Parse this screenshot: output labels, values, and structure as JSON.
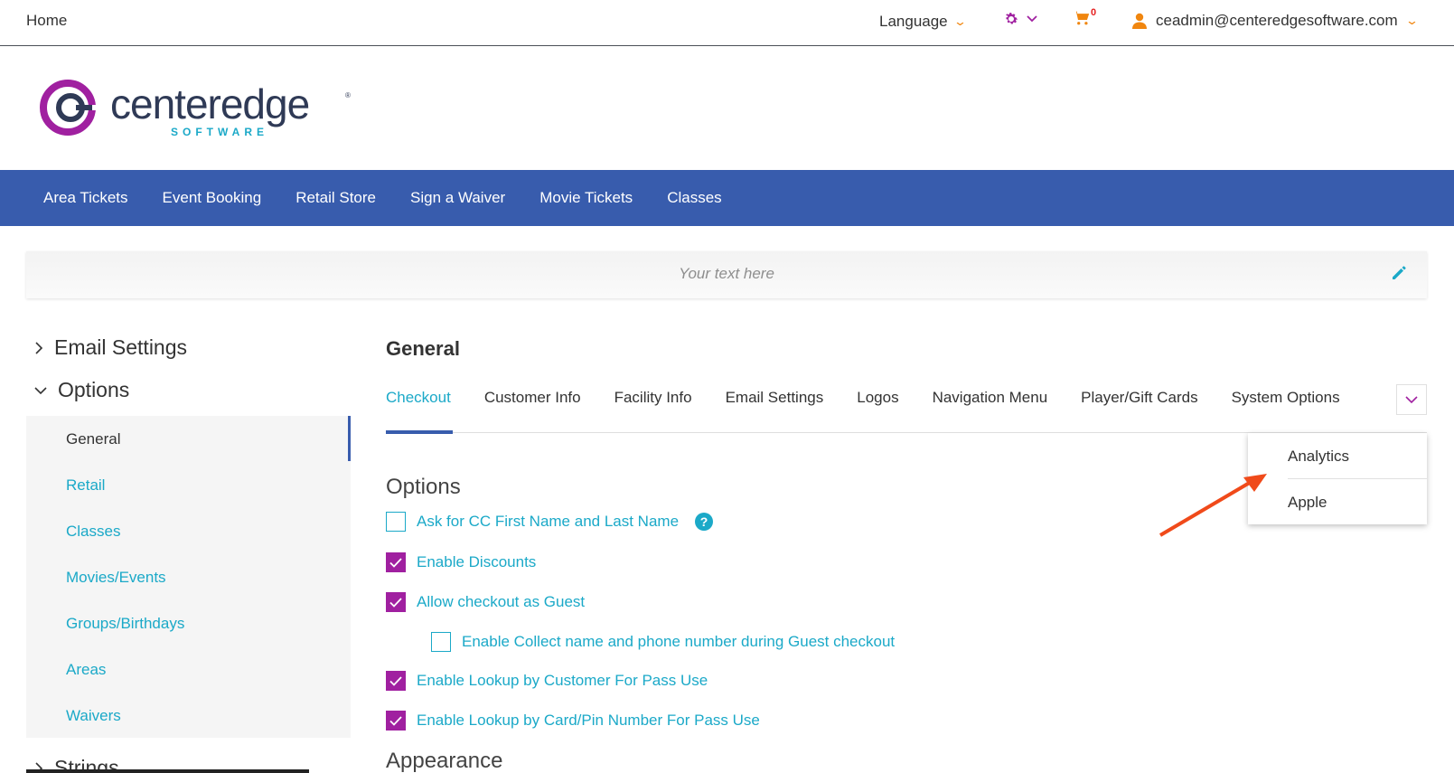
{
  "topbar": {
    "home": "Home",
    "language": "Language",
    "cart_count": "0",
    "user_email": "ceadmin@centeredgesoftware.com"
  },
  "logo": {
    "name": "centeredge",
    "sub": "SOFTWARE",
    "colors": {
      "primary": "#2f3a56",
      "accent": "#a020a0"
    }
  },
  "nav": {
    "items": [
      "Area Tickets",
      "Event Booking",
      "Retail Store",
      "Sign a Waiver",
      "Movie Tickets",
      "Classes"
    ]
  },
  "banner": {
    "text": "Your text here"
  },
  "sidebar": {
    "groups": [
      {
        "label": "Email Settings",
        "expanded": false
      },
      {
        "label": "Options",
        "expanded": true
      },
      {
        "label": "Strings",
        "expanded": false
      }
    ],
    "items": [
      "General",
      "Retail",
      "Classes",
      "Movies/Events",
      "Groups/Birthdays",
      "Areas",
      "Waivers"
    ],
    "active_item": "General"
  },
  "main": {
    "heading": "General",
    "tabs": [
      "Checkout",
      "Customer Info",
      "Facility Info",
      "Email Settings",
      "Logos",
      "Navigation Menu",
      "Player/Gift Cards",
      "System Options"
    ],
    "active_tab": "Checkout",
    "dropdown": [
      "Analytics",
      "Apple"
    ],
    "options_title": "Options",
    "options": [
      {
        "label": "Ask for CC First Name and Last Name",
        "checked": false,
        "help": "?"
      },
      {
        "label": "Enable Discounts",
        "checked": true
      },
      {
        "label": "Allow checkout as Guest",
        "checked": true
      },
      {
        "label": "Enable Collect name and phone number during Guest checkout",
        "checked": false
      },
      {
        "label": "Enable Lookup by Customer For Pass Use",
        "checked": true
      },
      {
        "label": "Enable Lookup by Card/Pin Number For Pass Use",
        "checked": true
      }
    ],
    "appearance_title": "Appearance"
  },
  "colors": {
    "nav_bg": "#385cad",
    "link": "#1ba9c8",
    "checkbox": "#a020a0",
    "accent_orange": "#f0860f",
    "annotation_arrow": "#f04a1a"
  }
}
